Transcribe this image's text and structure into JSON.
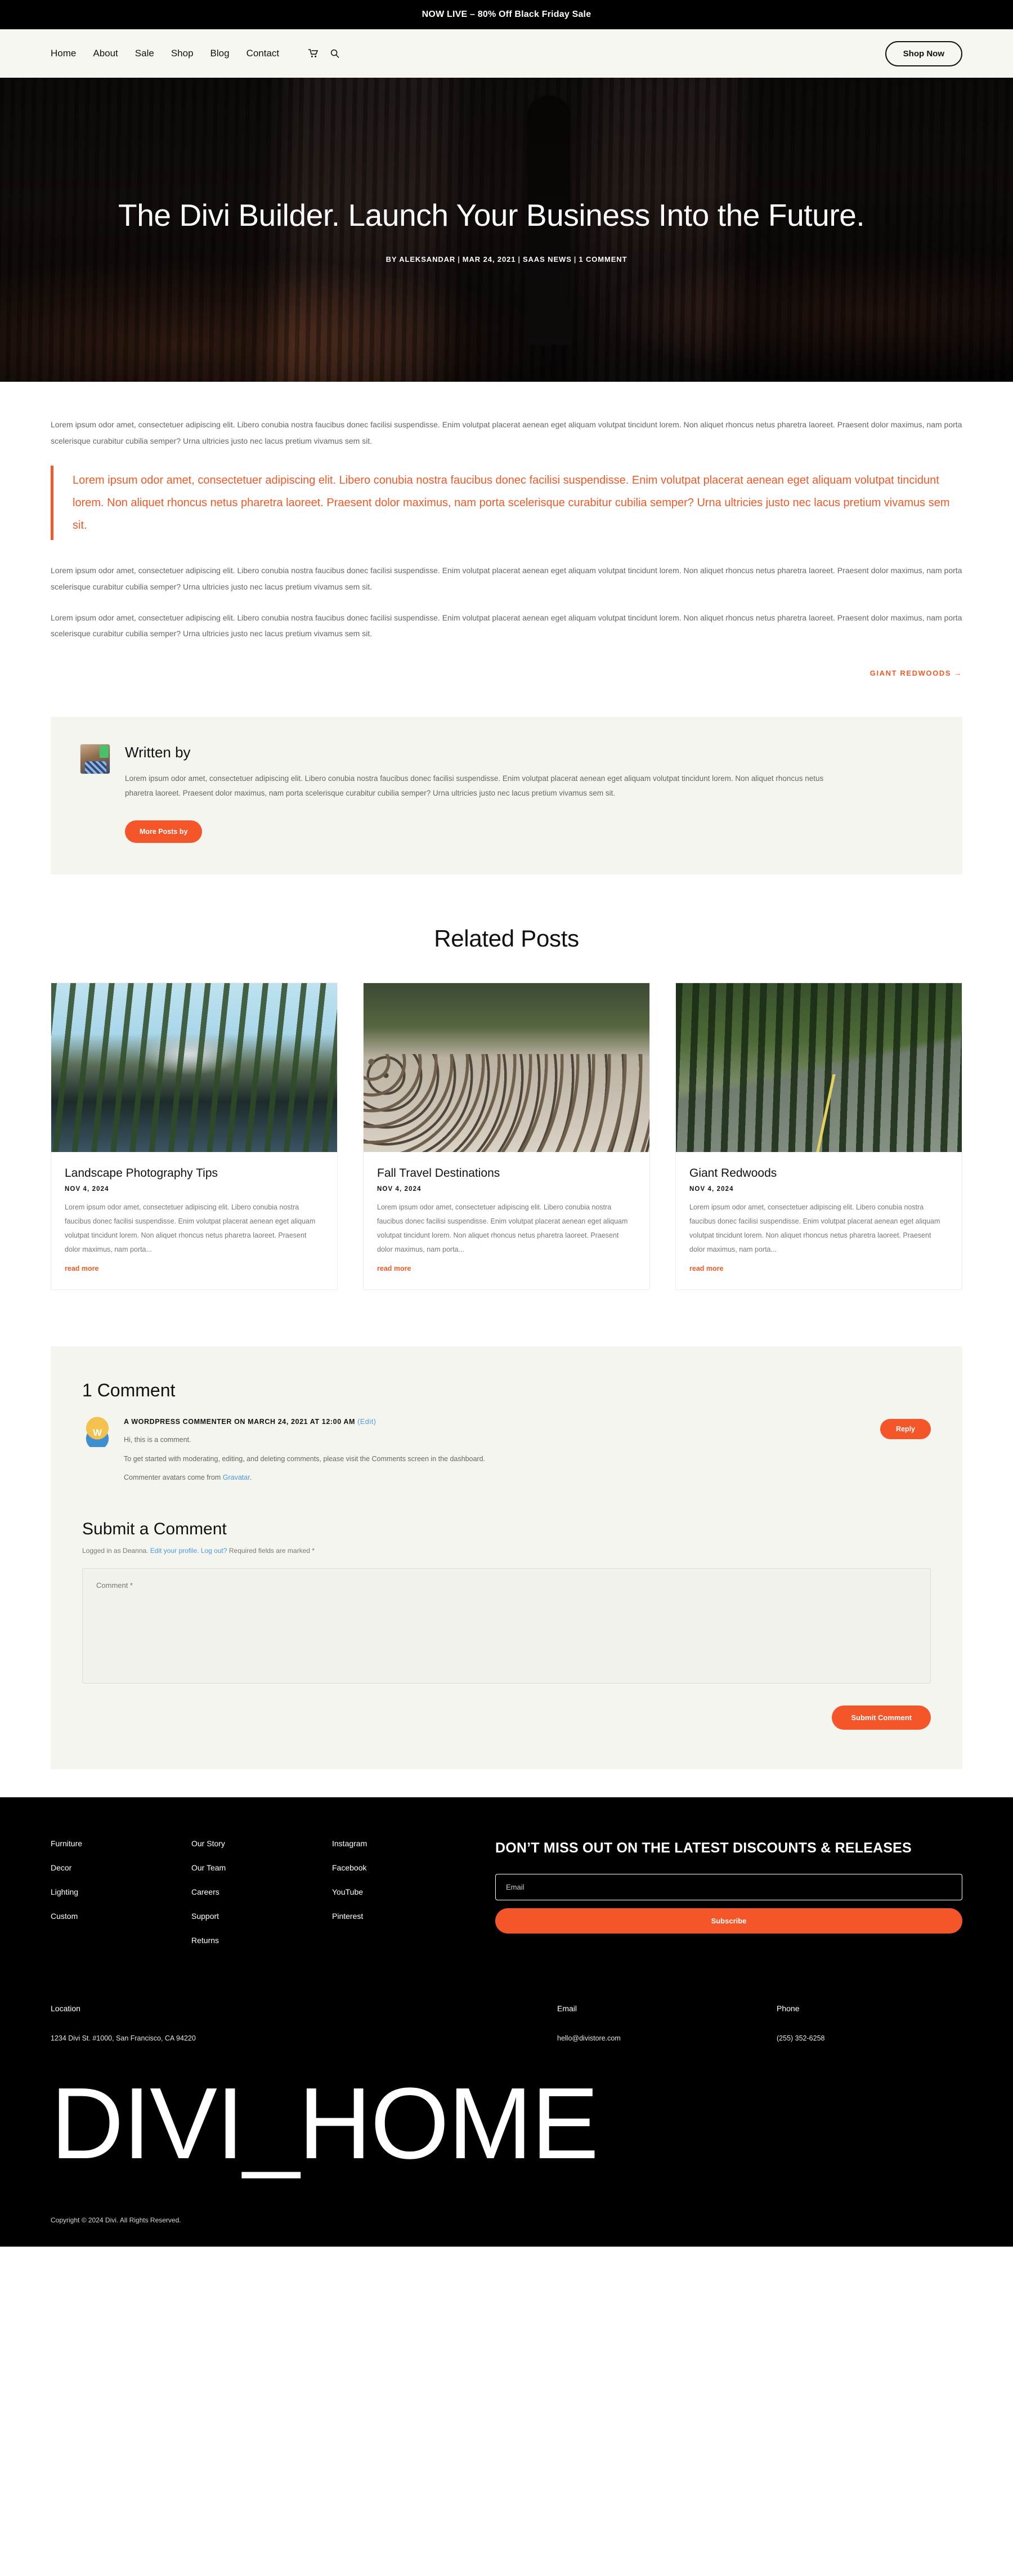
{
  "announcement": {
    "text": "NOW LIVE – 80% Off Black Friday Sale"
  },
  "nav": {
    "links": [
      {
        "label": "Home"
      },
      {
        "label": "About"
      },
      {
        "label": "Sale"
      },
      {
        "label": "Shop"
      },
      {
        "label": "Blog"
      },
      {
        "label": "Contact"
      }
    ],
    "icons": [
      {
        "name": "cart-icon"
      },
      {
        "name": "search-icon"
      }
    ],
    "cta": {
      "label": "Shop Now"
    }
  },
  "hero": {
    "title": "The Divi Builder. Launch Your Business Into the Future.",
    "meta": {
      "by": "BY ALEKSANDAR",
      "date": "MAR 24, 2021",
      "category": "SAAS NEWS",
      "comments": "1 COMMENT"
    }
  },
  "article": {
    "paragraph_1": "Lorem ipsum odor amet, consectetuer adipiscing elit. Libero conubia nostra faucibus donec facilisi suspendisse. Enim volutpat placerat aenean eget aliquam volutpat tincidunt lorem. Non aliquet rhoncus netus pharetra laoreet. Praesent dolor maximus, nam porta scelerisque curabitur cubilia semper? Urna ultricies justo nec lacus pretium vivamus sem sit.",
    "blockquote": "Lorem ipsum odor amet, consectetuer adipiscing elit. Libero conubia nostra faucibus donec facilisi suspendisse. Enim volutpat placerat aenean eget aliquam volutpat tincidunt lorem. Non aliquet rhoncus netus pharetra laoreet. Praesent dolor maximus, nam porta scelerisque curabitur cubilia semper? Urna ultricies justo nec lacus pretium vivamus sem sit.",
    "paragraph_2": "Lorem ipsum odor amet, consectetuer adipiscing elit. Libero conubia nostra faucibus donec facilisi suspendisse. Enim volutpat placerat aenean eget aliquam volutpat tincidunt lorem. Non aliquet rhoncus netus pharetra laoreet. Praesent dolor maximus, nam porta scelerisque curabitur cubilia semper? Urna ultricies justo nec lacus pretium vivamus sem sit.",
    "paragraph_3": "Lorem ipsum odor amet, consectetuer adipiscing elit. Libero conubia nostra faucibus donec facilisi suspendisse. Enim volutpat placerat aenean eget aliquam volutpat tincidunt lorem. Non aliquet rhoncus netus pharetra laoreet. Praesent dolor maximus, nam porta scelerisque curabitur cubilia semper? Urna ultricies justo nec lacus pretium vivamus sem sit.",
    "next_post_link": "GIANT REDWOODS →"
  },
  "author": {
    "heading": "Written by",
    "bio": "Lorem ipsum odor amet, consectetuer adipiscing elit. Libero conubia nostra faucibus donec facilisi suspendisse. Enim volutpat placerat aenean eget aliquam volutpat tincidunt lorem. Non aliquet rhoncus netus pharetra laoreet. Praesent dolor maximus, nam porta scelerisque curabitur cubilia semper? Urna ultricies justo nec lacus pretium vivamus sem sit.",
    "button_label": "More Posts by"
  },
  "related": {
    "heading": "Related Posts",
    "posts": [
      {
        "title": "Landscape Photography Tips",
        "date": "NOV 4, 2024",
        "excerpt": "Lorem ipsum odor amet, consectetuer adipiscing elit. Libero conubia nostra faucibus donec facilisi suspendisse. Enim volutpat placerat aenean eget aliquam volutpat tincidunt lorem. Non aliquet rhoncus netus pharetra laoreet. Praesent dolor maximus, nam porta...",
        "read_more": "read more"
      },
      {
        "title": "Fall Travel Destinations",
        "date": "NOV 4, 2024",
        "excerpt": "Lorem ipsum odor amet, consectetuer adipiscing elit. Libero conubia nostra faucibus donec facilisi suspendisse. Enim volutpat placerat aenean eget aliquam volutpat tincidunt lorem. Non aliquet rhoncus netus pharetra laoreet. Praesent dolor maximus, nam porta...",
        "read_more": "read more"
      },
      {
        "title": "Giant Redwoods",
        "date": "NOV 4, 2024",
        "excerpt": "Lorem ipsum odor amet, consectetuer adipiscing elit. Libero conubia nostra faucibus donec facilisi suspendisse. Enim volutpat placerat aenean eget aliquam volutpat tincidunt lorem. Non aliquet rhoncus netus pharetra laoreet. Praesent dolor maximus, nam porta...",
        "read_more": "read more"
      }
    ]
  },
  "comments": {
    "heading": "1 Comment",
    "item": {
      "author": "A WORDPRESS COMMENTER",
      "on_text": "ON MARCH 24, 2021 AT 12:00 AM",
      "edit_label": "(Edit)",
      "line_1": "Hi, this is a comment.",
      "line_2": "To get started with moderating, editing, and deleting comments, please visit the Comments screen in the dashboard.",
      "line_3_prefix": "Commenter avatars come from ",
      "line_3_link": "Gravatar",
      "line_3_suffix": ".",
      "reply_label": "Reply"
    },
    "form": {
      "heading": "Submit a Comment",
      "logged_in_prefix": "Logged in as Deanna. ",
      "edit_profile": "Edit your profile",
      "separator_1": ". ",
      "log_out": "Log out?",
      "required_note": " Required fields are marked *",
      "comment_placeholder": "Comment *",
      "submit_label": "Submit Comment"
    }
  },
  "footer": {
    "columns": [
      {
        "items": [
          {
            "label": "Furniture"
          },
          {
            "label": "Decor"
          },
          {
            "label": "Lighting"
          },
          {
            "label": "Custom"
          }
        ]
      },
      {
        "items": [
          {
            "label": "Our Story"
          },
          {
            "label": "Our Team"
          },
          {
            "label": "Careers"
          },
          {
            "label": "Support"
          },
          {
            "label": "Returns"
          }
        ]
      },
      {
        "items": [
          {
            "label": "Instagram"
          },
          {
            "label": "Facebook"
          },
          {
            "label": "YouTube"
          },
          {
            "label": "Pinterest"
          }
        ]
      }
    ],
    "newsletter": {
      "title": "DON’T MISS OUT ON THE LATEST DISCOUNTS & RELEASES",
      "email_placeholder": "Email",
      "subscribe_label": "Subscribe"
    },
    "contact": {
      "location_label": "Location",
      "location_value": "1234 Divi St. #1000, San Francisco, CA 94220",
      "email_label": "Email",
      "email_value": "hello@divistore.com",
      "phone_label": "Phone",
      "phone_value": "(255) 352-6258"
    },
    "wordmark": "DIVI_HOME",
    "copyright": "Copyright © 2024 Divi. All Rights Reserved."
  },
  "colors": {
    "accent": "#ef5a28",
    "button": "#f4562a",
    "link_blue": "#4a9ae0",
    "dark": "#000000",
    "nav_bg": "#f7f7f2",
    "panel_bg": "#f5f5f0"
  }
}
